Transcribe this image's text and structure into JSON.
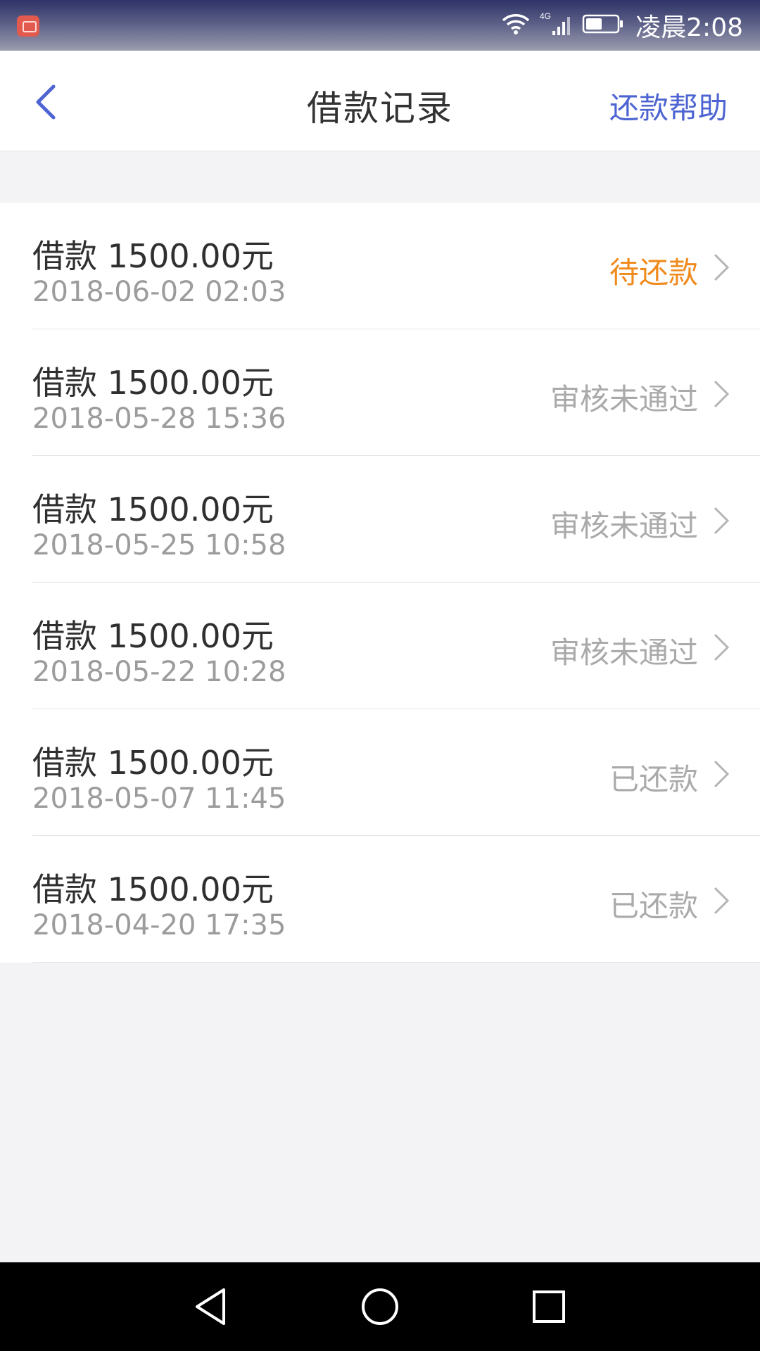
{
  "status_bar": {
    "icons": [
      "notification-icon",
      "wifi-icon",
      "4g-icon",
      "signal-icon",
      "battery-icon"
    ],
    "network_label": "4G",
    "time": "凌晨2:08"
  },
  "header": {
    "back_icon": "chevron-left-icon",
    "title": "借款记录",
    "help_label": "还款帮助"
  },
  "colors": {
    "accent": "#4d64d2",
    "pending": "#f08a1c",
    "muted": "#aaaaaa"
  },
  "records": [
    {
      "amount": "借款 1500.00元",
      "date": "2018-06-02 02:03",
      "status": "待还款"
    },
    {
      "amount": "借款 1500.00元",
      "date": "2018-05-28 15:36",
      "status": "审核未通过"
    },
    {
      "amount": "借款 1500.00元",
      "date": "2018-05-25 10:58",
      "status": "审核未通过"
    },
    {
      "amount": "借款 1500.00元",
      "date": "2018-05-22 10:28",
      "status": "审核未通过"
    },
    {
      "amount": "借款 1500.00元",
      "date": "2018-05-07 11:45",
      "status": "已还款"
    },
    {
      "amount": "借款 1500.00元",
      "date": "2018-04-20 17:35",
      "status": "已还款"
    }
  ],
  "nav_bar": {
    "icons": [
      "back-triangle-icon",
      "home-circle-icon",
      "recents-square-icon"
    ]
  }
}
